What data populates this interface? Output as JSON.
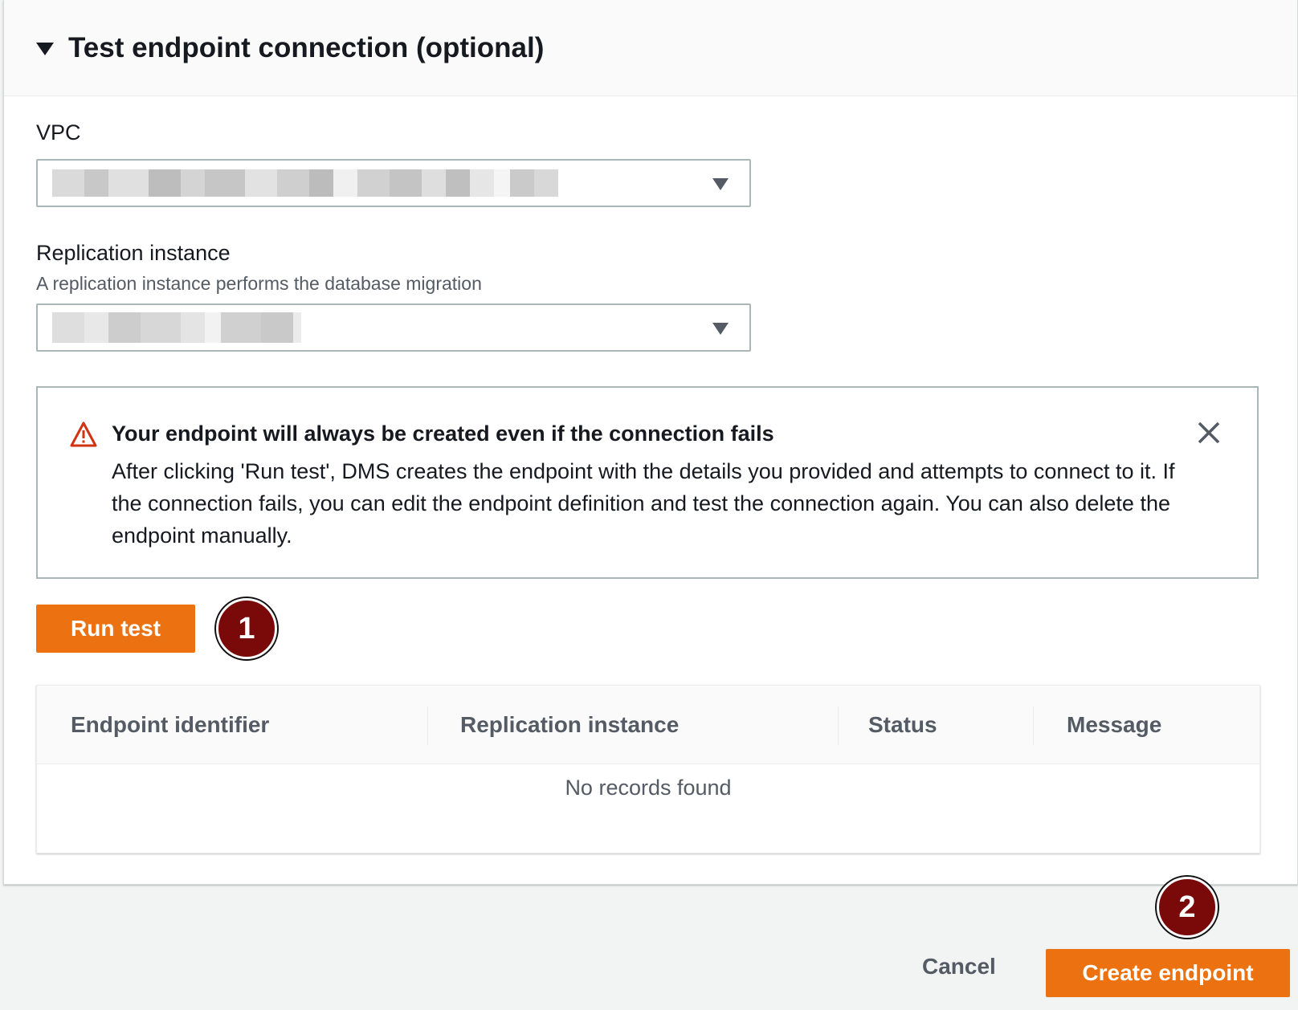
{
  "section": {
    "title": "Test endpoint connection (optional)"
  },
  "vpc": {
    "label": "VPC",
    "value_redacted": true
  },
  "replication_instance": {
    "label": "Replication instance",
    "description": "A replication instance performs the database migration",
    "value_redacted": true
  },
  "alert": {
    "type": "warning",
    "title": "Your endpoint will always be created even if the connection fails",
    "body": "After clicking 'Run test', DMS creates the endpoint with the details you provided and attempts to connect to it. If the connection fails, you can edit the endpoint definition and test the connection again. You can also delete the endpoint manually."
  },
  "actions": {
    "run_test_label": "Run test",
    "cancel_label": "Cancel",
    "create_label": "Create endpoint"
  },
  "table": {
    "columns": [
      "Endpoint identifier",
      "Replication instance",
      "Status",
      "Message"
    ],
    "empty_text": "No records found"
  },
  "annotations": {
    "step1": "1",
    "step2": "2"
  },
  "colors": {
    "primary_button": "#ec7211",
    "badge": "#7a0a0a",
    "warning": "#d13212"
  }
}
